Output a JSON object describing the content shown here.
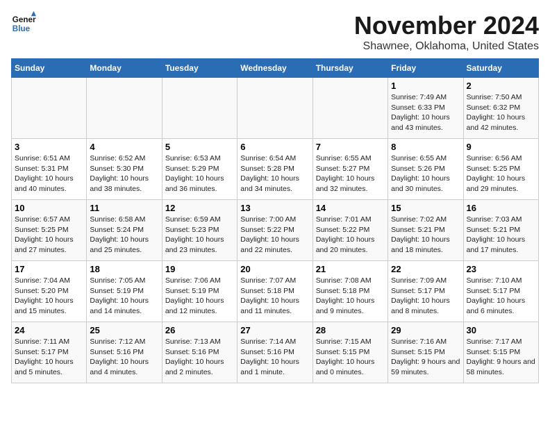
{
  "header": {
    "logo_line1": "General",
    "logo_line2": "Blue",
    "title": "November 2024",
    "subtitle": "Shawnee, Oklahoma, United States"
  },
  "weekdays": [
    "Sunday",
    "Monday",
    "Tuesday",
    "Wednesday",
    "Thursday",
    "Friday",
    "Saturday"
  ],
  "weeks": [
    [
      {
        "day": "",
        "info": ""
      },
      {
        "day": "",
        "info": ""
      },
      {
        "day": "",
        "info": ""
      },
      {
        "day": "",
        "info": ""
      },
      {
        "day": "",
        "info": ""
      },
      {
        "day": "1",
        "info": "Sunrise: 7:49 AM\nSunset: 6:33 PM\nDaylight: 10 hours and 43 minutes."
      },
      {
        "day": "2",
        "info": "Sunrise: 7:50 AM\nSunset: 6:32 PM\nDaylight: 10 hours and 42 minutes."
      }
    ],
    [
      {
        "day": "3",
        "info": "Sunrise: 6:51 AM\nSunset: 5:31 PM\nDaylight: 10 hours and 40 minutes."
      },
      {
        "day": "4",
        "info": "Sunrise: 6:52 AM\nSunset: 5:30 PM\nDaylight: 10 hours and 38 minutes."
      },
      {
        "day": "5",
        "info": "Sunrise: 6:53 AM\nSunset: 5:29 PM\nDaylight: 10 hours and 36 minutes."
      },
      {
        "day": "6",
        "info": "Sunrise: 6:54 AM\nSunset: 5:28 PM\nDaylight: 10 hours and 34 minutes."
      },
      {
        "day": "7",
        "info": "Sunrise: 6:55 AM\nSunset: 5:27 PM\nDaylight: 10 hours and 32 minutes."
      },
      {
        "day": "8",
        "info": "Sunrise: 6:55 AM\nSunset: 5:26 PM\nDaylight: 10 hours and 30 minutes."
      },
      {
        "day": "9",
        "info": "Sunrise: 6:56 AM\nSunset: 5:25 PM\nDaylight: 10 hours and 29 minutes."
      }
    ],
    [
      {
        "day": "10",
        "info": "Sunrise: 6:57 AM\nSunset: 5:25 PM\nDaylight: 10 hours and 27 minutes."
      },
      {
        "day": "11",
        "info": "Sunrise: 6:58 AM\nSunset: 5:24 PM\nDaylight: 10 hours and 25 minutes."
      },
      {
        "day": "12",
        "info": "Sunrise: 6:59 AM\nSunset: 5:23 PM\nDaylight: 10 hours and 23 minutes."
      },
      {
        "day": "13",
        "info": "Sunrise: 7:00 AM\nSunset: 5:22 PM\nDaylight: 10 hours and 22 minutes."
      },
      {
        "day": "14",
        "info": "Sunrise: 7:01 AM\nSunset: 5:22 PM\nDaylight: 10 hours and 20 minutes."
      },
      {
        "day": "15",
        "info": "Sunrise: 7:02 AM\nSunset: 5:21 PM\nDaylight: 10 hours and 18 minutes."
      },
      {
        "day": "16",
        "info": "Sunrise: 7:03 AM\nSunset: 5:21 PM\nDaylight: 10 hours and 17 minutes."
      }
    ],
    [
      {
        "day": "17",
        "info": "Sunrise: 7:04 AM\nSunset: 5:20 PM\nDaylight: 10 hours and 15 minutes."
      },
      {
        "day": "18",
        "info": "Sunrise: 7:05 AM\nSunset: 5:19 PM\nDaylight: 10 hours and 14 minutes."
      },
      {
        "day": "19",
        "info": "Sunrise: 7:06 AM\nSunset: 5:19 PM\nDaylight: 10 hours and 12 minutes."
      },
      {
        "day": "20",
        "info": "Sunrise: 7:07 AM\nSunset: 5:18 PM\nDaylight: 10 hours and 11 minutes."
      },
      {
        "day": "21",
        "info": "Sunrise: 7:08 AM\nSunset: 5:18 PM\nDaylight: 10 hours and 9 minutes."
      },
      {
        "day": "22",
        "info": "Sunrise: 7:09 AM\nSunset: 5:17 PM\nDaylight: 10 hours and 8 minutes."
      },
      {
        "day": "23",
        "info": "Sunrise: 7:10 AM\nSunset: 5:17 PM\nDaylight: 10 hours and 6 minutes."
      }
    ],
    [
      {
        "day": "24",
        "info": "Sunrise: 7:11 AM\nSunset: 5:17 PM\nDaylight: 10 hours and 5 minutes."
      },
      {
        "day": "25",
        "info": "Sunrise: 7:12 AM\nSunset: 5:16 PM\nDaylight: 10 hours and 4 minutes."
      },
      {
        "day": "26",
        "info": "Sunrise: 7:13 AM\nSunset: 5:16 PM\nDaylight: 10 hours and 2 minutes."
      },
      {
        "day": "27",
        "info": "Sunrise: 7:14 AM\nSunset: 5:16 PM\nDaylight: 10 hours and 1 minute."
      },
      {
        "day": "28",
        "info": "Sunrise: 7:15 AM\nSunset: 5:15 PM\nDaylight: 10 hours and 0 minutes."
      },
      {
        "day": "29",
        "info": "Sunrise: 7:16 AM\nSunset: 5:15 PM\nDaylight: 9 hours and 59 minutes."
      },
      {
        "day": "30",
        "info": "Sunrise: 7:17 AM\nSunset: 5:15 PM\nDaylight: 9 hours and 58 minutes."
      }
    ]
  ]
}
